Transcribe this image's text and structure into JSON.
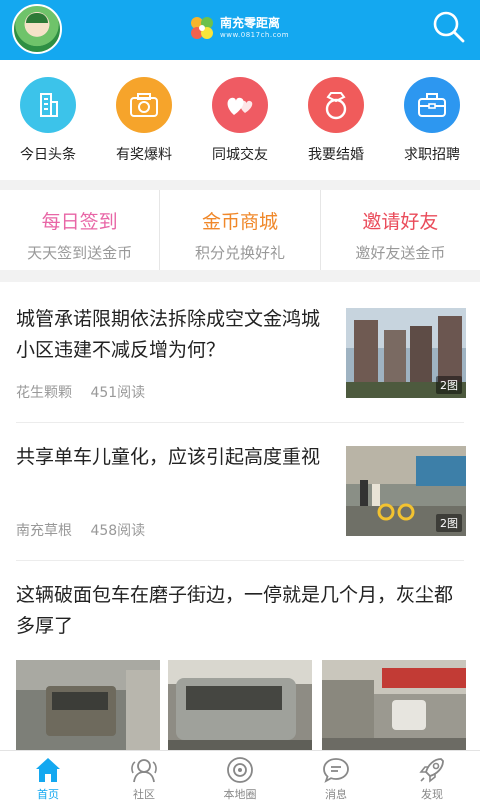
{
  "header": {
    "logo_title": "南充零距离",
    "logo_url": "www.0817ch.com"
  },
  "categories": [
    {
      "label": "今日头条",
      "icon": "building-icon",
      "color": "#3cc3ea"
    },
    {
      "label": "有奖爆料",
      "icon": "camera-icon",
      "color": "#f6a42b"
    },
    {
      "label": "同城交友",
      "icon": "hearts-icon",
      "color": "#ef5b63"
    },
    {
      "label": "我要结婚",
      "icon": "ring-icon",
      "color": "#f05b5b"
    },
    {
      "label": "求职招聘",
      "icon": "briefcase-icon",
      "color": "#2d97f0"
    }
  ],
  "promos": [
    {
      "title": "每日签到",
      "subtitle": "天天签到送金币",
      "color": "#e866a6"
    },
    {
      "title": "金币商城",
      "subtitle": "积分兑换好礼",
      "color": "#f0882a"
    },
    {
      "title": "邀请好友",
      "subtitle": "邀好友送金币",
      "color": "#ea4b5a"
    }
  ],
  "articles": [
    {
      "title": "城管承诺限期依法拆除成空文金鸿城小区违建不减反增为何？",
      "source": "花生颗颗",
      "reads": "451阅读",
      "image_badge": "2图"
    },
    {
      "title": "共享单车儿童化，应该引起高度重视",
      "source": "南充草根",
      "reads": "458阅读",
      "image_badge": "2图"
    },
    {
      "title": "这辆破面包车在磨子街边，一停就是几个月，灰尘都多厚了"
    }
  ],
  "tabs": [
    {
      "label": "首页",
      "icon": "home-icon",
      "active": true
    },
    {
      "label": "社区",
      "icon": "community-icon",
      "active": false
    },
    {
      "label": "本地圈",
      "icon": "local-circle-icon",
      "active": false
    },
    {
      "label": "消息",
      "icon": "message-icon",
      "active": false
    },
    {
      "label": "发现",
      "icon": "rocket-icon",
      "active": false
    }
  ],
  "colors": {
    "brand": "#14a8f0",
    "tab_active": "#14a8f0",
    "tab_inactive": "#888888"
  }
}
